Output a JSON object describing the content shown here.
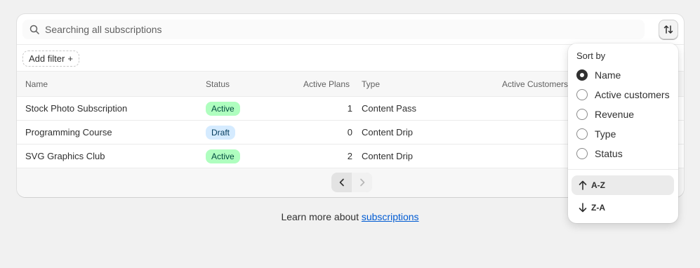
{
  "search": {
    "placeholder": "Searching all subscriptions"
  },
  "filters": {
    "add_filter_label": "Add filter",
    "add_icon": "+"
  },
  "table": {
    "headers": {
      "name": "Name",
      "status": "Status",
      "active_plans": "Active Plans",
      "type": "Type",
      "active_customers": "Active Customers"
    },
    "rows": [
      {
        "name": "Stock Photo Subscription",
        "status": "Active",
        "active_plans": "1",
        "type": "Content Pass"
      },
      {
        "name": "Programming Course",
        "status": "Draft",
        "active_plans": "0",
        "type": "Content Drip"
      },
      {
        "name": "SVG Graphics Club",
        "status": "Active",
        "active_plans": "2",
        "type": "Content Drip"
      }
    ]
  },
  "footer": {
    "learn_prefix": "Learn more about ",
    "learn_link": "subscriptions"
  },
  "sort_popover": {
    "title": "Sort by",
    "options": [
      "Name",
      "Active customers",
      "Revenue",
      "Type",
      "Status"
    ],
    "selected": "Name",
    "directions": [
      {
        "label": "A-Z",
        "icon": "arrow-up-icon",
        "selected": true
      },
      {
        "label": "Z-A",
        "icon": "arrow-down-icon",
        "selected": false
      }
    ]
  },
  "colors": {
    "active_badge_bg": "#affebf",
    "draft_badge_bg": "#d5ebff",
    "link": "#005bd3"
  }
}
